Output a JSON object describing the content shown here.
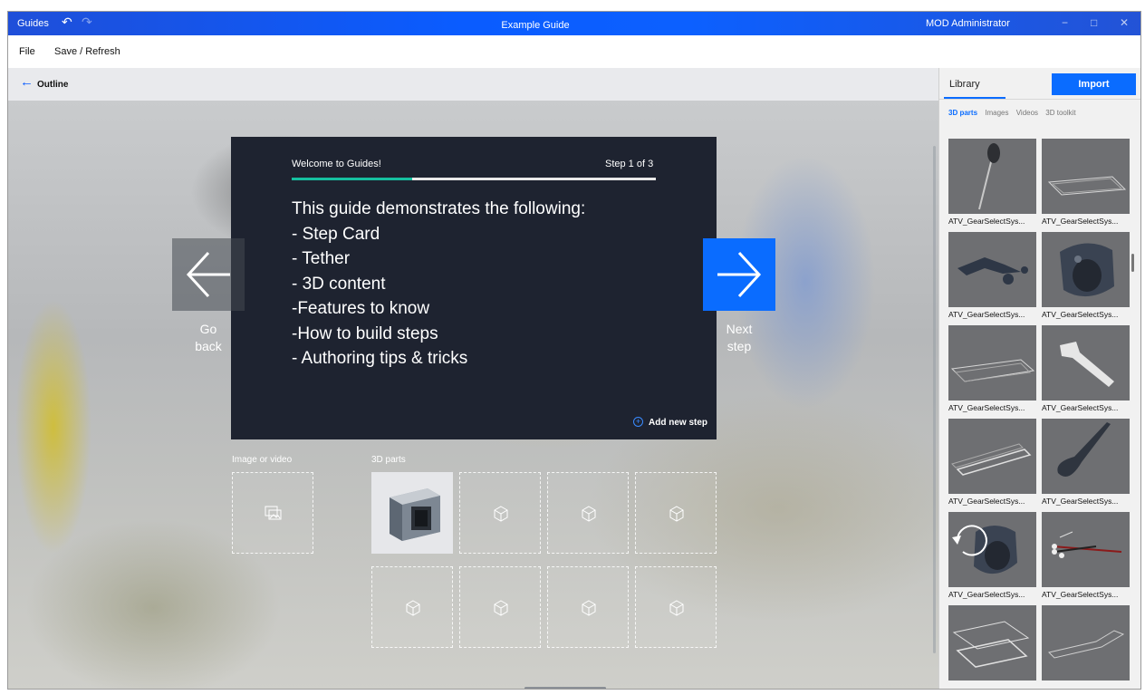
{
  "titlebar": {
    "app_name": "Guides",
    "undo_icon": "undo-icon",
    "redo_icon": "redo-icon",
    "document_title": "Example Guide",
    "user": "MOD Administrator",
    "minimize": "−",
    "maximize": "□",
    "close": "✕"
  },
  "menubar": {
    "file": "File",
    "save_refresh": "Save / Refresh"
  },
  "outline": {
    "back_arrow": "←",
    "label": "Outline"
  },
  "step_card": {
    "title": "Welcome to Guides!",
    "step_indicator": "Step 1 of 3",
    "progress": 0.33,
    "lines": [
      "This guide demonstrates the following:",
      "- Step Card",
      "- Tether",
      "- 3D content",
      "-Features to know",
      "-How to build steps",
      "- Authoring tips & tricks"
    ],
    "add_step": "Add new step"
  },
  "nav": {
    "back_line1": "Go",
    "back_line2": "back",
    "next_line1": "Next",
    "next_line2": "step"
  },
  "slots": {
    "image_label": "Image or video",
    "parts_label": "3D parts",
    "parts_count": 8
  },
  "library": {
    "tab": "Library",
    "import": "Import",
    "filters": [
      "3D parts",
      "Images",
      "Videos",
      "3D toolkit"
    ],
    "items": [
      "ATV_GearSelectSys...",
      "ATV_GearSelectSys...",
      "ATV_GearSelectSys...",
      "ATV_GearSelectSys...",
      "ATV_GearSelectSys...",
      "ATV_GearSelectSys...",
      "ATV_GearSelectSys...",
      "ATV_GearSelectSys...",
      "ATV_GearSelectSys...",
      "ATV_GearSelectSys...",
      "",
      ""
    ]
  },
  "colors": {
    "accent": "#0a6cff",
    "progress": "#16c0a0",
    "card": "#1e2330"
  }
}
